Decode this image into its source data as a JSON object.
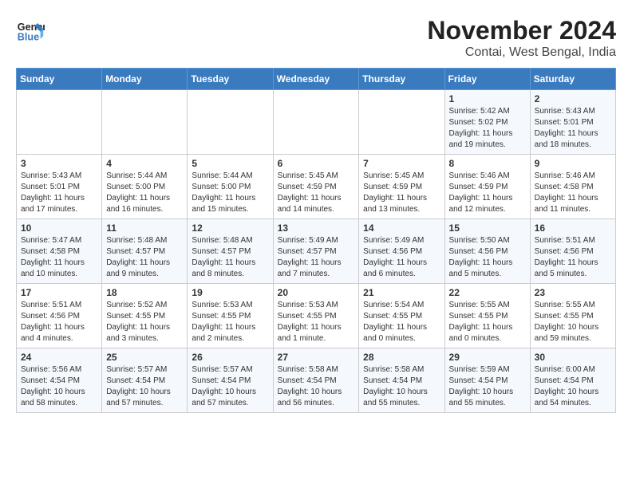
{
  "header": {
    "logo_line1": "General",
    "logo_line2": "Blue",
    "month": "November 2024",
    "location": "Contai, West Bengal, India"
  },
  "weekdays": [
    "Sunday",
    "Monday",
    "Tuesday",
    "Wednesday",
    "Thursday",
    "Friday",
    "Saturday"
  ],
  "weeks": [
    [
      {
        "day": "",
        "sunrise": "",
        "sunset": "",
        "daylight": ""
      },
      {
        "day": "",
        "sunrise": "",
        "sunset": "",
        "daylight": ""
      },
      {
        "day": "",
        "sunrise": "",
        "sunset": "",
        "daylight": ""
      },
      {
        "day": "",
        "sunrise": "",
        "sunset": "",
        "daylight": ""
      },
      {
        "day": "",
        "sunrise": "",
        "sunset": "",
        "daylight": ""
      },
      {
        "day": "1",
        "sunrise": "Sunrise: 5:42 AM",
        "sunset": "Sunset: 5:02 PM",
        "daylight": "Daylight: 11 hours and 19 minutes."
      },
      {
        "day": "2",
        "sunrise": "Sunrise: 5:43 AM",
        "sunset": "Sunset: 5:01 PM",
        "daylight": "Daylight: 11 hours and 18 minutes."
      }
    ],
    [
      {
        "day": "3",
        "sunrise": "Sunrise: 5:43 AM",
        "sunset": "Sunset: 5:01 PM",
        "daylight": "Daylight: 11 hours and 17 minutes."
      },
      {
        "day": "4",
        "sunrise": "Sunrise: 5:44 AM",
        "sunset": "Sunset: 5:00 PM",
        "daylight": "Daylight: 11 hours and 16 minutes."
      },
      {
        "day": "5",
        "sunrise": "Sunrise: 5:44 AM",
        "sunset": "Sunset: 5:00 PM",
        "daylight": "Daylight: 11 hours and 15 minutes."
      },
      {
        "day": "6",
        "sunrise": "Sunrise: 5:45 AM",
        "sunset": "Sunset: 4:59 PM",
        "daylight": "Daylight: 11 hours and 14 minutes."
      },
      {
        "day": "7",
        "sunrise": "Sunrise: 5:45 AM",
        "sunset": "Sunset: 4:59 PM",
        "daylight": "Daylight: 11 hours and 13 minutes."
      },
      {
        "day": "8",
        "sunrise": "Sunrise: 5:46 AM",
        "sunset": "Sunset: 4:59 PM",
        "daylight": "Daylight: 11 hours and 12 minutes."
      },
      {
        "day": "9",
        "sunrise": "Sunrise: 5:46 AM",
        "sunset": "Sunset: 4:58 PM",
        "daylight": "Daylight: 11 hours and 11 minutes."
      }
    ],
    [
      {
        "day": "10",
        "sunrise": "Sunrise: 5:47 AM",
        "sunset": "Sunset: 4:58 PM",
        "daylight": "Daylight: 11 hours and 10 minutes."
      },
      {
        "day": "11",
        "sunrise": "Sunrise: 5:48 AM",
        "sunset": "Sunset: 4:57 PM",
        "daylight": "Daylight: 11 hours and 9 minutes."
      },
      {
        "day": "12",
        "sunrise": "Sunrise: 5:48 AM",
        "sunset": "Sunset: 4:57 PM",
        "daylight": "Daylight: 11 hours and 8 minutes."
      },
      {
        "day": "13",
        "sunrise": "Sunrise: 5:49 AM",
        "sunset": "Sunset: 4:57 PM",
        "daylight": "Daylight: 11 hours and 7 minutes."
      },
      {
        "day": "14",
        "sunrise": "Sunrise: 5:49 AM",
        "sunset": "Sunset: 4:56 PM",
        "daylight": "Daylight: 11 hours and 6 minutes."
      },
      {
        "day": "15",
        "sunrise": "Sunrise: 5:50 AM",
        "sunset": "Sunset: 4:56 PM",
        "daylight": "Daylight: 11 hours and 5 minutes."
      },
      {
        "day": "16",
        "sunrise": "Sunrise: 5:51 AM",
        "sunset": "Sunset: 4:56 PM",
        "daylight": "Daylight: 11 hours and 5 minutes."
      }
    ],
    [
      {
        "day": "17",
        "sunrise": "Sunrise: 5:51 AM",
        "sunset": "Sunset: 4:56 PM",
        "daylight": "Daylight: 11 hours and 4 minutes."
      },
      {
        "day": "18",
        "sunrise": "Sunrise: 5:52 AM",
        "sunset": "Sunset: 4:55 PM",
        "daylight": "Daylight: 11 hours and 3 minutes."
      },
      {
        "day": "19",
        "sunrise": "Sunrise: 5:53 AM",
        "sunset": "Sunset: 4:55 PM",
        "daylight": "Daylight: 11 hours and 2 minutes."
      },
      {
        "day": "20",
        "sunrise": "Sunrise: 5:53 AM",
        "sunset": "Sunset: 4:55 PM",
        "daylight": "Daylight: 11 hours and 1 minute."
      },
      {
        "day": "21",
        "sunrise": "Sunrise: 5:54 AM",
        "sunset": "Sunset: 4:55 PM",
        "daylight": "Daylight: 11 hours and 0 minutes."
      },
      {
        "day": "22",
        "sunrise": "Sunrise: 5:55 AM",
        "sunset": "Sunset: 4:55 PM",
        "daylight": "Daylight: 11 hours and 0 minutes."
      },
      {
        "day": "23",
        "sunrise": "Sunrise: 5:55 AM",
        "sunset": "Sunset: 4:55 PM",
        "daylight": "Daylight: 10 hours and 59 minutes."
      }
    ],
    [
      {
        "day": "24",
        "sunrise": "Sunrise: 5:56 AM",
        "sunset": "Sunset: 4:54 PM",
        "daylight": "Daylight: 10 hours and 58 minutes."
      },
      {
        "day": "25",
        "sunrise": "Sunrise: 5:57 AM",
        "sunset": "Sunset: 4:54 PM",
        "daylight": "Daylight: 10 hours and 57 minutes."
      },
      {
        "day": "26",
        "sunrise": "Sunrise: 5:57 AM",
        "sunset": "Sunset: 4:54 PM",
        "daylight": "Daylight: 10 hours and 57 minutes."
      },
      {
        "day": "27",
        "sunrise": "Sunrise: 5:58 AM",
        "sunset": "Sunset: 4:54 PM",
        "daylight": "Daylight: 10 hours and 56 minutes."
      },
      {
        "day": "28",
        "sunrise": "Sunrise: 5:58 AM",
        "sunset": "Sunset: 4:54 PM",
        "daylight": "Daylight: 10 hours and 55 minutes."
      },
      {
        "day": "29",
        "sunrise": "Sunrise: 5:59 AM",
        "sunset": "Sunset: 4:54 PM",
        "daylight": "Daylight: 10 hours and 55 minutes."
      },
      {
        "day": "30",
        "sunrise": "Sunrise: 6:00 AM",
        "sunset": "Sunset: 4:54 PM",
        "daylight": "Daylight: 10 hours and 54 minutes."
      }
    ]
  ]
}
